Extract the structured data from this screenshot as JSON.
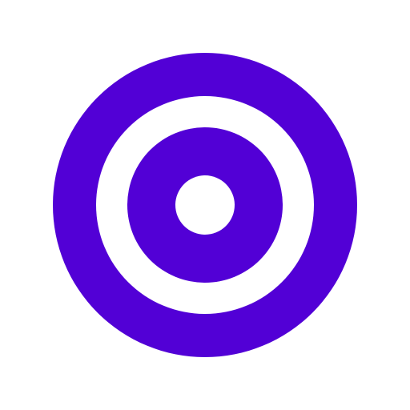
{
  "icon": {
    "name": "target-icon",
    "colors": {
      "ring": "#5200d6",
      "background": "#ffffff"
    }
  }
}
